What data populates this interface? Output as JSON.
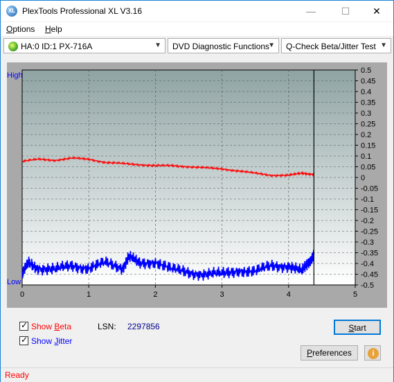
{
  "window": {
    "title": "PlexTools Professional XL V3.16",
    "app_icon_text": "XL"
  },
  "titlebar_controls": {
    "minimize": "—",
    "maximize": "☐",
    "close": "✕"
  },
  "menu": {
    "options": "ptions",
    "options_hotkey": "O",
    "help": "elp",
    "help_hotkey": "H"
  },
  "toolbar": {
    "drive": "HA:0 ID:1  PX-716A",
    "function": "DVD Diagnostic Functions",
    "test": "Q-Check Beta/Jitter Test"
  },
  "chart_data": {
    "type": "line",
    "left_axis_labels": {
      "top": "High",
      "bottom": "Low"
    },
    "x_ticks": [
      "0",
      "1",
      "2",
      "3",
      "4",
      "5"
    ],
    "xlim": [
      0,
      5
    ],
    "y_right_ticks": [
      "0.5",
      "0.45",
      "0.4",
      "0.35",
      "0.3",
      "0.25",
      "0.2",
      "0.15",
      "0.1",
      "0.05",
      "0",
      "-0.05",
      "-0.1",
      "-0.15",
      "-0.2",
      "-0.25",
      "-0.3",
      "-0.35",
      "-0.4",
      "-0.45",
      "-0.5"
    ],
    "ylim": [
      -0.5,
      0.5
    ],
    "grid": true,
    "end_marker_x": 4.38,
    "series": [
      {
        "color": "#ff0000",
        "x": [
          0,
          0.25,
          0.5,
          0.75,
          1.0,
          1.25,
          1.5,
          1.75,
          2.0,
          2.25,
          2.5,
          2.75,
          3.0,
          3.25,
          3.5,
          3.75,
          4.0,
          4.2,
          4.38
        ],
        "y": [
          0.075,
          0.085,
          0.08,
          0.09,
          0.085,
          0.07,
          0.065,
          0.06,
          0.055,
          0.055,
          0.05,
          0.045,
          0.04,
          0.03,
          0.02,
          0.01,
          0.01,
          0.02,
          0.015
        ]
      },
      {
        "color": "#0000ff",
        "x": [
          0,
          0.1,
          0.25,
          0.5,
          0.75,
          1.0,
          1.25,
          1.5,
          1.6,
          1.75,
          2.0,
          2.25,
          2.5,
          2.75,
          3.0,
          3.25,
          3.5,
          3.75,
          4.0,
          4.2,
          4.3,
          4.38
        ],
        "y": [
          -0.45,
          -0.4,
          -0.42,
          -0.43,
          -0.41,
          -0.42,
          -0.4,
          -0.42,
          -0.37,
          -0.4,
          -0.39,
          -0.43,
          -0.44,
          -0.45,
          -0.45,
          -0.43,
          -0.44,
          -0.41,
          -0.41,
          -0.44,
          -0.39,
          -0.36
        ]
      }
    ]
  },
  "controls": {
    "show_beta": {
      "prefix": "Show ",
      "hotkey": "B",
      "rest": "eta",
      "checked": "✓",
      "color": "#ff0000"
    },
    "show_jitter": {
      "prefix": "Show ",
      "hotkey": "J",
      "rest": "itter",
      "checked": "✓",
      "color": "#0000ff"
    },
    "lsn_label": "LSN:",
    "lsn_value": "2297856",
    "start_label": "Start",
    "start_hotkey": "S",
    "start_rest": "tart",
    "preferences_label": "references",
    "preferences_hotkey": "P",
    "info_icon": "i"
  },
  "status": {
    "text": "Ready",
    "color": "#ff0000"
  }
}
